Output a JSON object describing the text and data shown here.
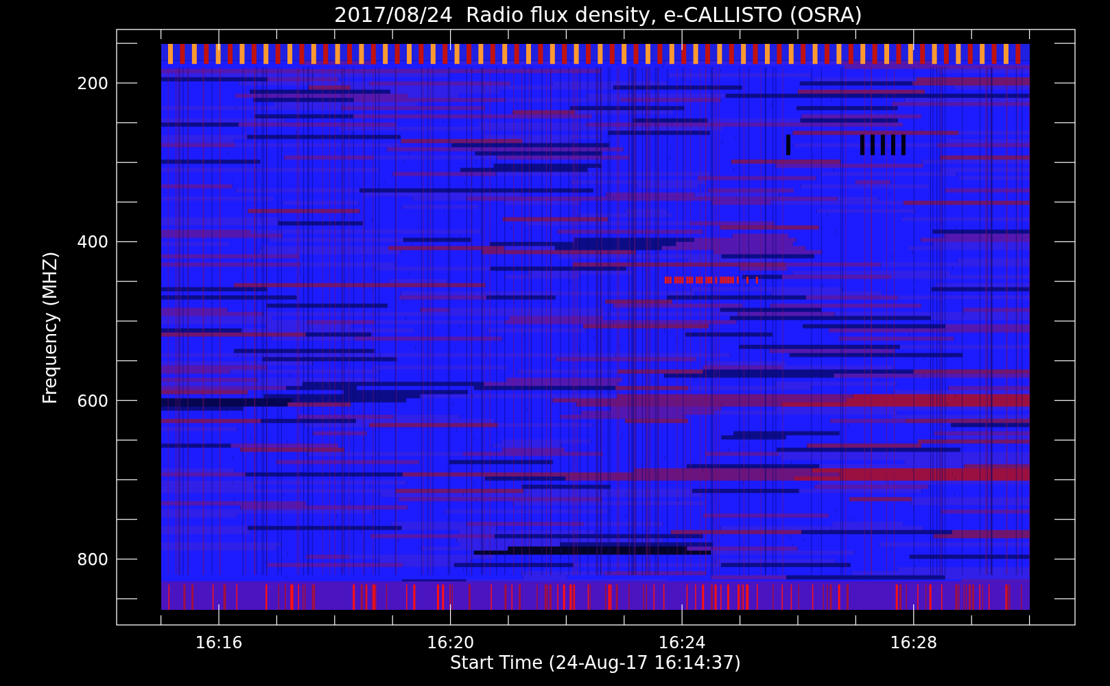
{
  "title": "2017/08/24  Radio flux density, e-CALLISTO (OSRA)",
  "y_axis": {
    "label": "Frequency (MHZ)",
    "tick_labels": [
      "200",
      "400",
      "600",
      "800"
    ]
  },
  "x_axis": {
    "label": "Start Time (24-Aug-17 16:14:37)",
    "tick_labels": [
      "16:16",
      "16:20",
      "16:24",
      "16:28"
    ]
  }
}
